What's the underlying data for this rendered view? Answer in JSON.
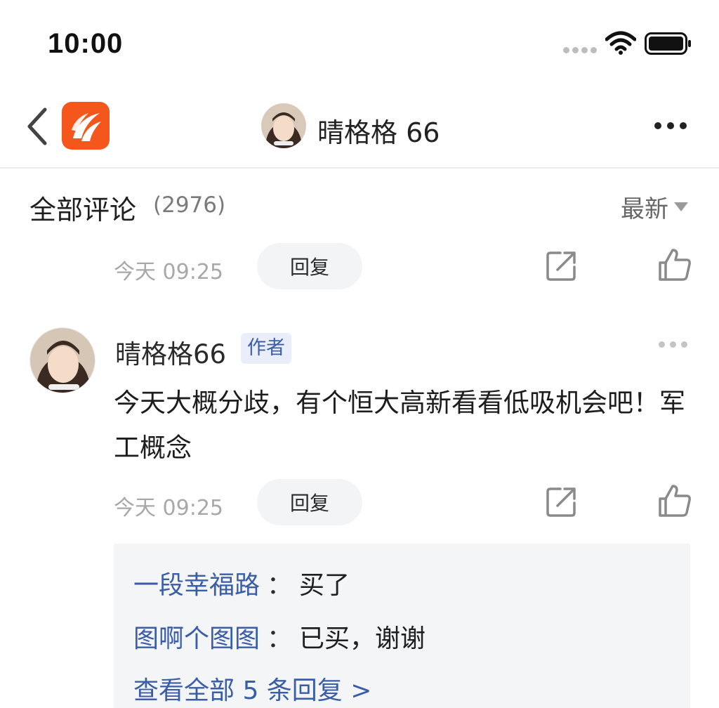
{
  "status_bar": {
    "time": "10:00"
  },
  "nav": {
    "title": "晴格格 66"
  },
  "comments_header": {
    "title": "全部评论",
    "count": "(2976)",
    "sort_label": "最新"
  },
  "previous_comment": {
    "timestamp": "今天 09:25",
    "reply_label": "回复"
  },
  "comment": {
    "author": "晴格格66",
    "badge": "作者",
    "text": "今天大概分歧，有个恒大高新看看低吸机会吧！军工概念",
    "timestamp": "今天 09:25",
    "reply_label": "回复"
  },
  "replies": {
    "items": [
      {
        "user": "一段幸福路",
        "separator": "：",
        "text": "买了"
      },
      {
        "user": "图啊个图图",
        "separator": "：",
        "text": "已买，谢谢"
      }
    ],
    "view_all": "查看全部 5 条回复 >"
  },
  "icons": {
    "back": "chevron-left-icon",
    "logo": "app-logo",
    "more": "more-horizontal-icon",
    "share": "share-icon",
    "like": "thumbs-up-icon",
    "wifi": "wifi-icon",
    "battery": "battery-icon",
    "sort": "triangle-down-icon"
  },
  "colors": {
    "logo": "#f5561b",
    "link": "#3a5da8",
    "badge_bg": "#e9eefa",
    "reply_bg": "#f4f5f7"
  }
}
